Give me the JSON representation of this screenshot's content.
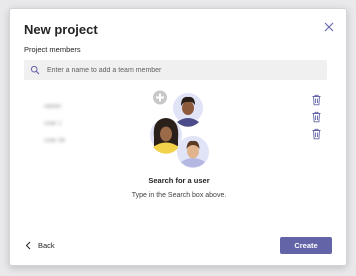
{
  "dialog": {
    "title": "New project",
    "close_icon": "close-icon"
  },
  "members_section": {
    "label": "Project members",
    "search": {
      "placeholder": "Enter a name to add a team member",
      "value": "",
      "icon": "search-icon"
    },
    "members": [
      {
        "name": "Admin",
        "action_icon": "trash-icon"
      },
      {
        "name": "User 2",
        "action_icon": "trash-icon"
      },
      {
        "name": "User 99",
        "action_icon": "trash-icon"
      }
    ]
  },
  "empty_state": {
    "title": "Search for a user",
    "description": "Type in the Search box above."
  },
  "footer": {
    "back_label": "Back",
    "create_label": "Create"
  },
  "colors": {
    "accent": "#6264a7",
    "search_bg": "#f0f0f0",
    "text": "#252423"
  }
}
